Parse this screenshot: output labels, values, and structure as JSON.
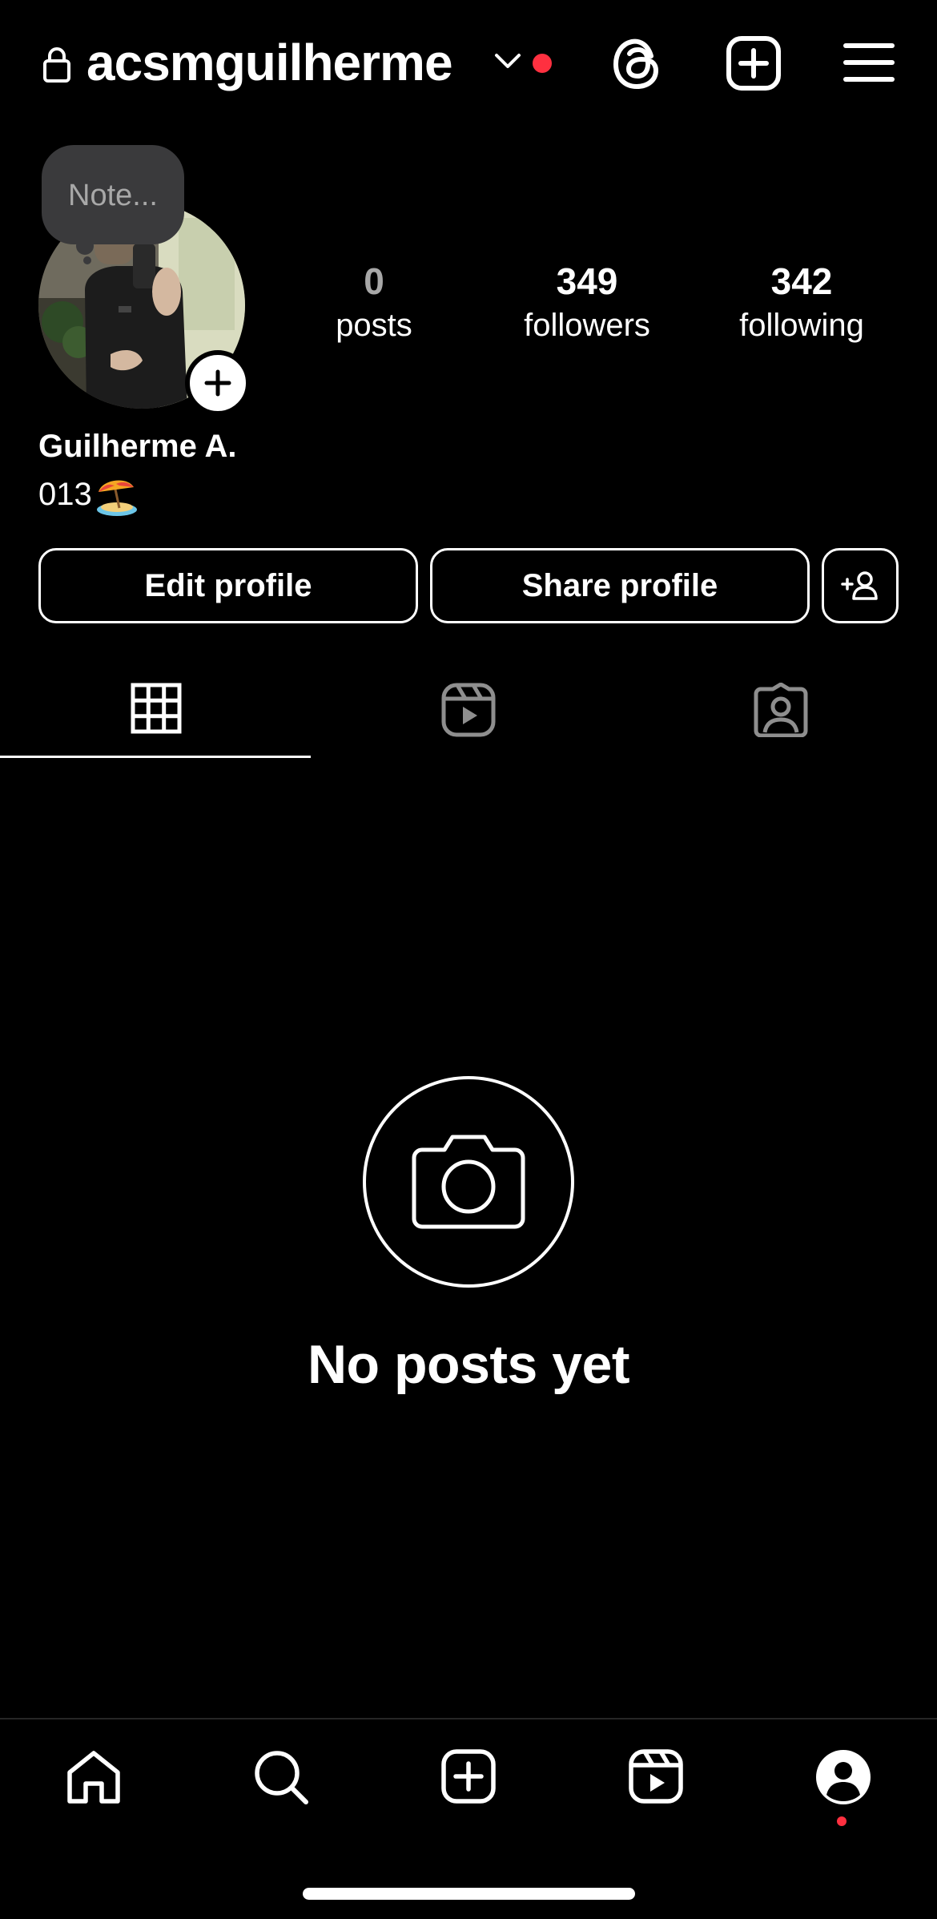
{
  "header": {
    "username": "acsmguilherme",
    "icons": {
      "lock": "lock-icon",
      "chevron": "chevron-down-icon",
      "threads": "threads-icon",
      "create": "plus-square-icon",
      "menu": "hamburger-menu-icon"
    },
    "notification_dot_color": "#ff3040"
  },
  "profile": {
    "note_placeholder": "Note...",
    "display_name": "Guilherme A.",
    "bio": "013",
    "bio_emoji_icon": "beach-umbrella-icon",
    "stats": {
      "posts": {
        "value": "0",
        "label": "posts"
      },
      "followers": {
        "value": "349",
        "label": "followers"
      },
      "following": {
        "value": "342",
        "label": "following"
      }
    }
  },
  "actions": {
    "edit_profile": "Edit profile",
    "share_profile": "Share profile",
    "discover_people_icon": "add-person-icon"
  },
  "tabs": [
    {
      "icon": "grid-icon",
      "active": true
    },
    {
      "icon": "reels-icon",
      "active": false
    },
    {
      "icon": "tagged-icon",
      "active": false
    }
  ],
  "empty_state": {
    "icon": "camera-icon",
    "title": "No posts yet"
  },
  "bottom_nav": {
    "items": [
      "home-icon",
      "search-icon",
      "create-icon",
      "reels-icon",
      "profile-icon"
    ],
    "active": "profile-icon",
    "dot_color": "#ff3040"
  },
  "colors": {
    "background": "#000000",
    "text": "#ffffff",
    "muted": "#a8a8a8",
    "note_bubble": "#3a3a3c",
    "accent_red": "#ff3040"
  }
}
